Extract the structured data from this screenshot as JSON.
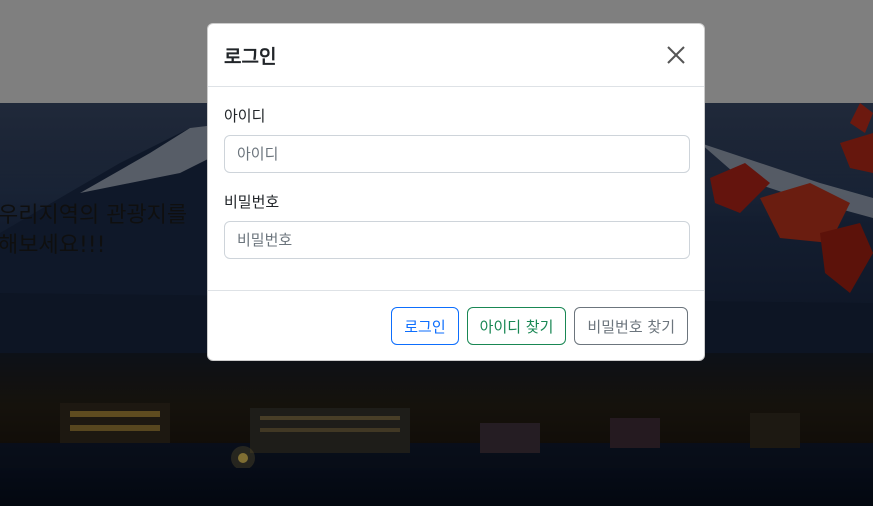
{
  "hero": {
    "line1": "우리지역의 관광지를",
    "line2": "해보세요!!!"
  },
  "modal": {
    "title": "로그인",
    "close_icon": "close-icon",
    "fields": {
      "id_label": "아이디",
      "id_placeholder": "아이디",
      "password_label": "비밀번호",
      "password_placeholder": "비밀번호"
    },
    "buttons": {
      "login": "로그인",
      "find_id": "아이디 찾기",
      "find_password": "비밀번호 찾기"
    }
  },
  "colors": {
    "primary": "#0d6efd",
    "success": "#198754",
    "secondary": "#6c757d",
    "backdrop": "rgba(0,0,0,0.5)"
  }
}
